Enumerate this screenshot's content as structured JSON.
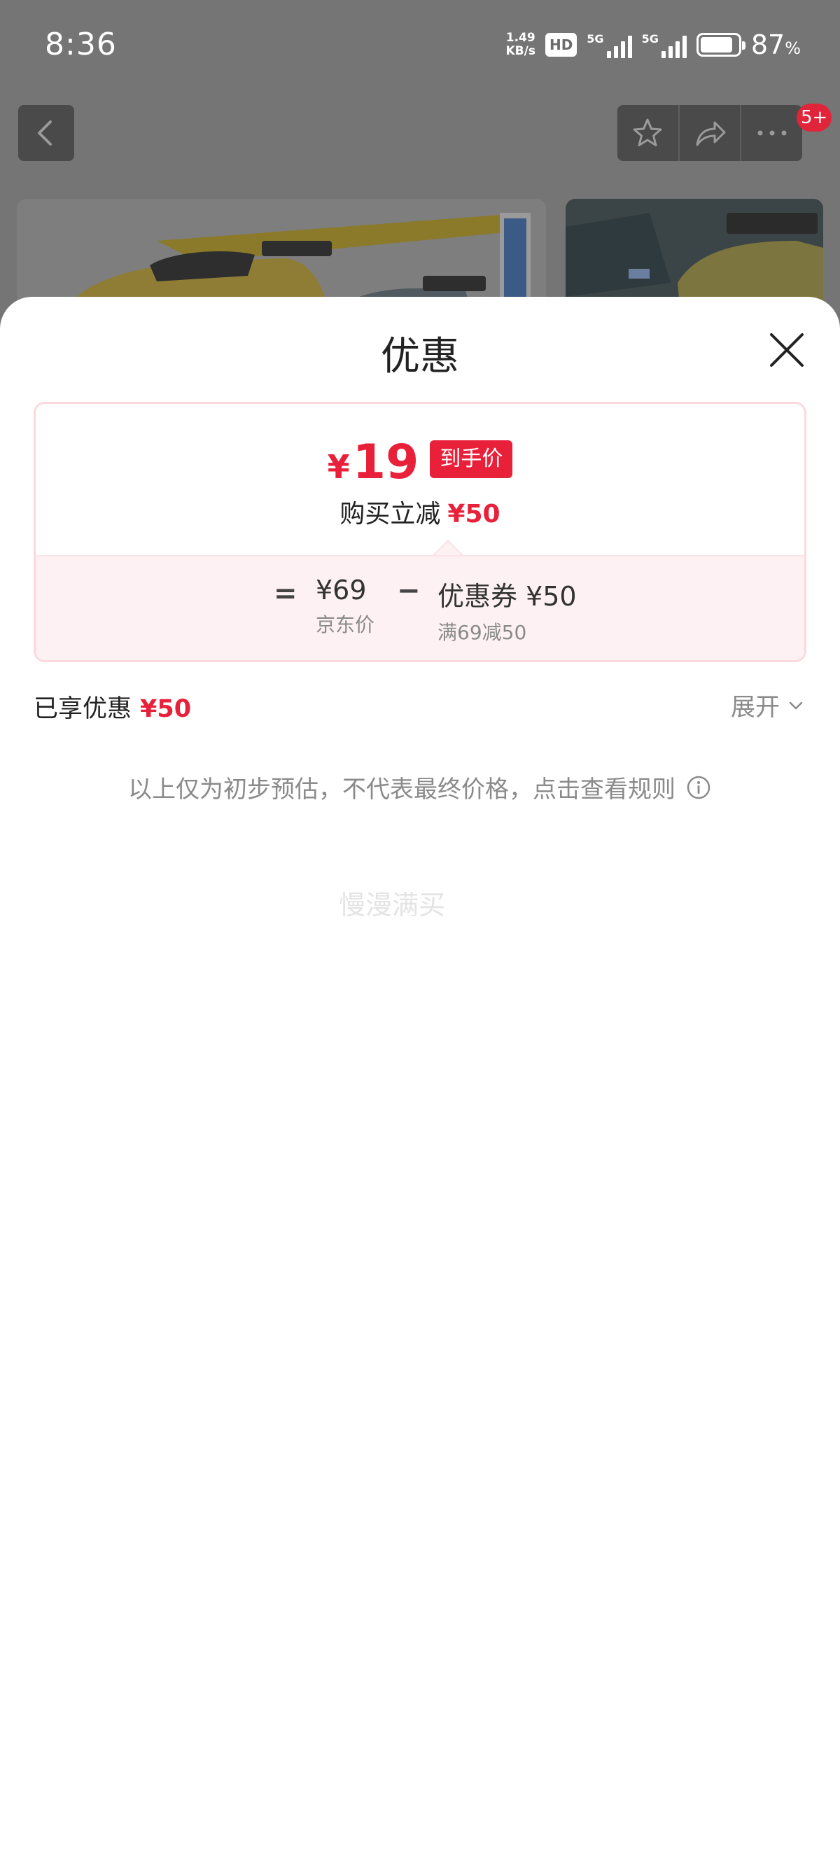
{
  "status_bar": {
    "time": "8:36",
    "net_speed_value": "1.49",
    "net_speed_unit": "KB/s",
    "hd": "HD",
    "sim1": "5G",
    "sim2": "5G",
    "battery_percent": "87",
    "battery_unit": "%"
  },
  "background": {
    "notification_badge": "5+"
  },
  "sheet": {
    "title": "优惠",
    "final_price": {
      "currency": "¥",
      "value": "19",
      "tag": "到手价"
    },
    "reduce": {
      "label": "购买立减",
      "amount": "¥50"
    },
    "formula": {
      "equals": "=",
      "base_price": "¥69",
      "base_label": "京东价",
      "minus": "−",
      "coupon_label_main": "优惠券 ¥50",
      "coupon_condition": "满69减50"
    },
    "enjoyed": {
      "label": "已享优惠",
      "amount": "¥50"
    },
    "expand_label": "展开",
    "disclaimer": "以上仅为初步预估，不代表最终价格，点击查看规则",
    "watermark": "慢漫满买"
  },
  "colors": {
    "accent_red": "#e8203a",
    "card_border": "#fbd9df",
    "card_tint": "#fdf1f3"
  }
}
